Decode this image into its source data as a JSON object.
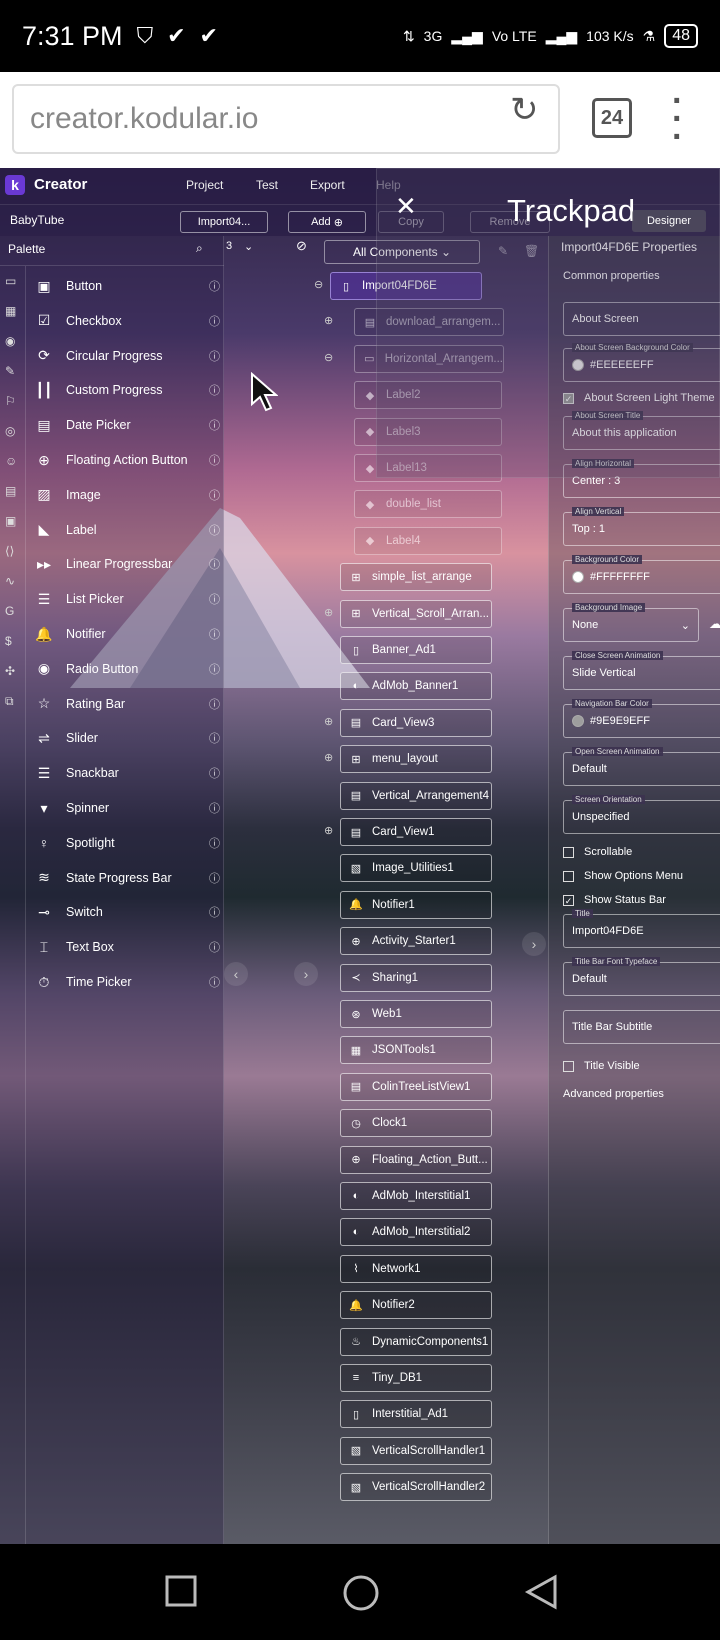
{
  "status": {
    "time": "7:31 PM",
    "net_type": "3G",
    "lte": "Vo LTE",
    "speed": "103 K/s",
    "battery": "48"
  },
  "browser": {
    "url": "creator.kodular.io",
    "tab_count": "24"
  },
  "app": {
    "brand": "Creator",
    "menu": [
      "Project",
      "Test",
      "Export",
      "Help"
    ],
    "project": "BabyTube",
    "screen_selector": "Import04...",
    "add_label": "Add",
    "copy_label": "Copy",
    "remove_label": "Remove",
    "designer_label": "Designer",
    "palette_title": "Palette",
    "screen_number": "3"
  },
  "palette": [
    "Button",
    "Checkbox",
    "Circular Progress",
    "Custom Progress",
    "Date Picker",
    "Floating Action Button",
    "Image",
    "Label",
    "Linear Progressbar",
    "List Picker",
    "Notifier",
    "Radio Button",
    "Rating Bar",
    "Slider",
    "Snackbar",
    "Spinner",
    "Spotlight",
    "State Progress Bar",
    "Switch",
    "Text Box",
    "Time Picker"
  ],
  "tree": {
    "filter": "All Components",
    "nodes": [
      "Import04FD6E",
      "download_arrangem...",
      "Horizontal_Arrangem...",
      "Label2",
      "Label3",
      "Label13",
      "double_list",
      "Label4",
      "simple_list_arrange",
      "Vertical_Scroll_Arran...",
      "Banner_Ad1",
      "AdMob_Banner1",
      "Card_View3",
      "menu_layout",
      "Vertical_Arrangement4",
      "Card_View1",
      "Image_Utilities1",
      "Notifier1",
      "Activity_Starter1",
      "Sharing1",
      "Web1",
      "JSONTools1",
      "ColinTreeListView1",
      "Clock1",
      "Floating_Action_Butt...",
      "AdMob_Interstitial1",
      "AdMob_Interstitial2",
      "Network1",
      "Notifier2",
      "DynamicComponents1",
      "Tiny_DB1",
      "Interstitial_Ad1",
      "VerticalScrollHandler1",
      "VerticalScrollHandler2"
    ]
  },
  "props": {
    "title": "Import04FD6E Properties",
    "common": "Common properties",
    "about_screen": "About Screen",
    "bg_label": "About Screen Background Color",
    "bg_value": "#EEEEEEFF",
    "light_theme": "About Screen Light Theme",
    "about_title_label": "About Screen Title",
    "about_title_value": "About this application",
    "align_h_label": "Align Horizontal",
    "align_h_value": "Center : 3",
    "align_v_label": "Align Vertical",
    "align_v_value": "Top : 1",
    "bgc_label": "Background Color",
    "bgc_value": "#FFFFFFFF",
    "bgi_label": "Background Image",
    "bgi_value": "None",
    "close_anim_label": "Close Screen Animation",
    "close_anim_value": "Slide Vertical",
    "navbar_label": "Navigation Bar Color",
    "navbar_value": "#9E9E9EFF",
    "open_anim_label": "Open Screen Animation",
    "open_anim_value": "Default",
    "orient_label": "Screen Orientation",
    "orient_value": "Unspecified",
    "scrollable": "Scrollable",
    "show_options": "Show Options Menu",
    "show_status": "Show Status Bar",
    "title_label": "Title",
    "title_value": "Import04FD6E",
    "font_label": "Title Bar Font Typeface",
    "font_value": "Default",
    "subtitle": "Title Bar Subtitle",
    "title_visible": "Title Visible",
    "advanced": "Advanced properties"
  },
  "trackpad": {
    "title": "Trackpad"
  }
}
